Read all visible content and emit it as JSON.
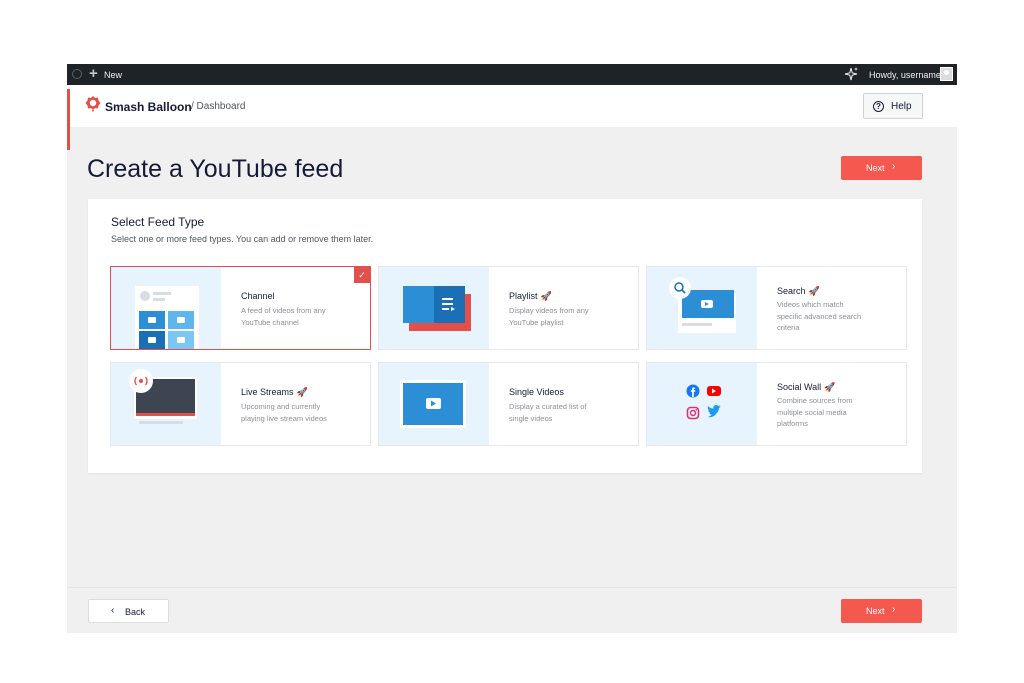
{
  "admin_bar": {
    "new_label": "New",
    "howdy": "Howdy, username"
  },
  "header": {
    "brand": "Smash Balloon",
    "breadcrumb": "/ Dashboard",
    "help_label": "Help"
  },
  "page": {
    "title": "Create a YouTube feed",
    "next_label": "Next"
  },
  "feed_type": {
    "heading": "Select Feed Type",
    "subheading": "Select one or more feed types. You can add or remove them later.",
    "cards": [
      {
        "title": "Channel",
        "desc1": "A feed of videos from any",
        "desc2": "YouTube channel",
        "selected": true
      },
      {
        "title": "Playlist",
        "desc1": "Display videos from any",
        "desc2": "YouTube playlist",
        "pro": true
      },
      {
        "title": "Search",
        "desc1": "Videos which match",
        "desc2": "specific advanced search",
        "desc3": "criteria",
        "pro": true
      },
      {
        "title": "Live Streams",
        "desc1": "Upcoming and currently",
        "desc2": "playing live stream videos",
        "pro": true
      },
      {
        "title": "Single Videos",
        "desc1": "Display a curated list of",
        "desc2": "single videos"
      },
      {
        "title": "Social Wall",
        "desc1": "Combine sources from",
        "desc2": "multiple social media",
        "desc3": "platforms",
        "pro": true
      }
    ]
  },
  "footer": {
    "back_label": "Back",
    "next_label": "Next"
  },
  "colors": {
    "accent": "#f5584f",
    "brand_red": "#e34f4b",
    "admin_bar": "#1d2327",
    "thumb_bg": "#e8f4fd",
    "youtube_blue": "#2c8fd6"
  },
  "icons": [
    "wordpress-icon",
    "plus-icon",
    "sparkle-icon",
    "help-icon",
    "chevron-right-icon",
    "chevron-left-icon",
    "check-icon",
    "rocket-icon",
    "facebook-icon",
    "youtube-icon",
    "instagram-icon",
    "twitter-icon",
    "search-icon",
    "live-icon"
  ]
}
